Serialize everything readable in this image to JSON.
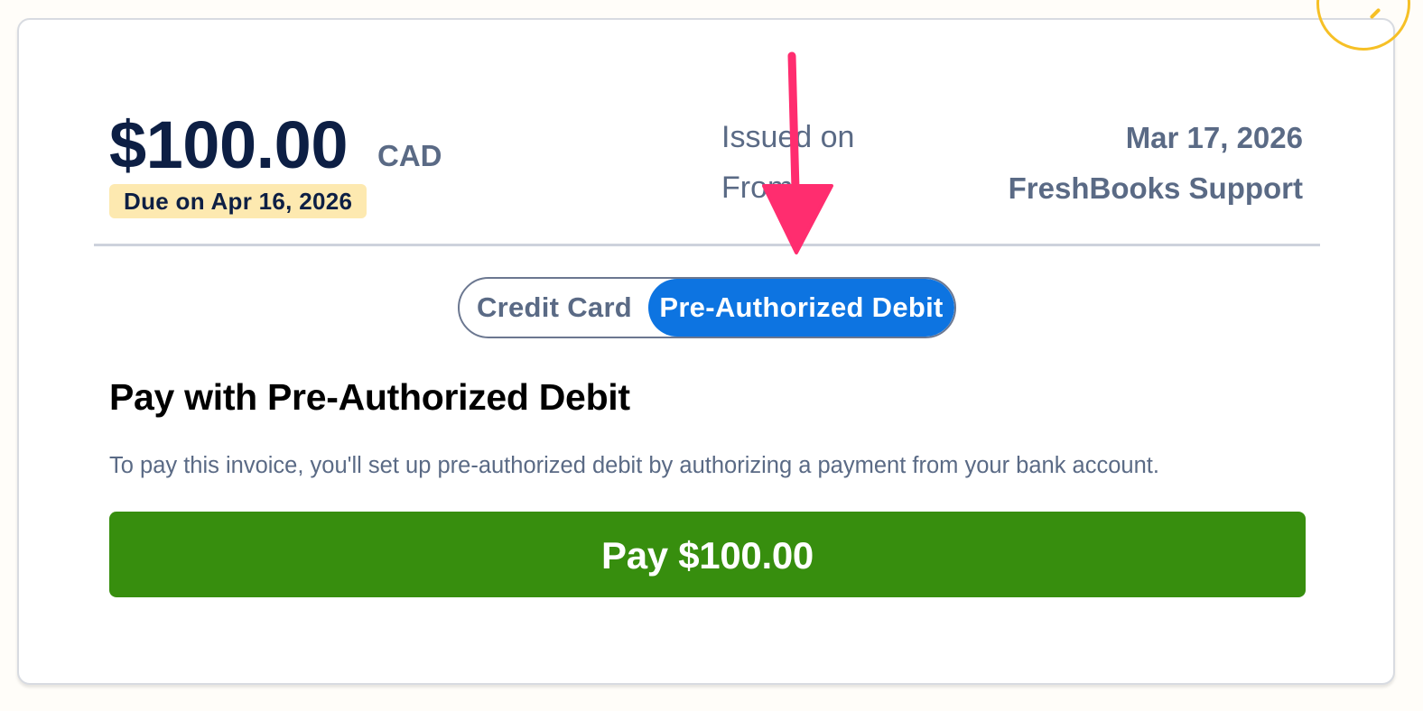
{
  "invoice": {
    "amount": "$100.00",
    "currency": "CAD",
    "due_label": "Due on Apr 16, 2026",
    "issued_label": "Issued on",
    "issued_value": "Mar 17, 2026",
    "from_label": "From",
    "from_value": "FreshBooks Support"
  },
  "payment_toggle": {
    "options": [
      "Credit Card",
      "Pre-Authorized Debit"
    ],
    "selected": "Pre-Authorized Debit"
  },
  "payment_section": {
    "title": "Pay with Pre-Authorized Debit",
    "description": "To pay this invoice, you'll set up pre-authorized debit by authorizing a payment from your bank account.",
    "pay_button_label": "Pay $100.00"
  },
  "colors": {
    "selected_toggle": "#0d74e1",
    "pay_button": "#378e0e",
    "due_badge": "#fde9b0",
    "annotation_arrow": "#ff2d6f"
  },
  "icons": {
    "corner_badge": "check-icon",
    "annotation": "arrow-down-icon"
  }
}
